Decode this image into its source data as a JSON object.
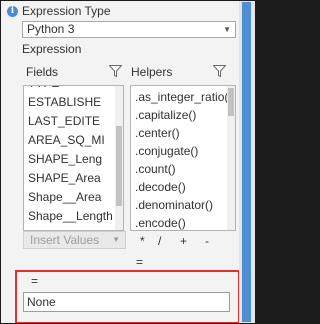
{
  "expression_type": {
    "label": "Expression Type",
    "selected": "Python 3"
  },
  "expression_label": "Expression",
  "fields": {
    "label": "Fields",
    "items": [
      "TYPE",
      "ESTABLISHE",
      "LAST_EDITE",
      "AREA_SQ_MI",
      "SHAPE_Leng",
      "SHAPE_Area",
      "Shape__Area",
      "Shape__Length"
    ]
  },
  "helpers": {
    "label": "Helpers",
    "items": [
      ".as_integer_ratio()",
      ".capitalize()",
      ".center()",
      ".conjugate()",
      ".count()",
      ".decode()",
      ".denominator()",
      ".encode()"
    ]
  },
  "insert_values": "Insert Values",
  "operators": [
    "*",
    "/",
    "+",
    "-",
    "="
  ],
  "result": {
    "label": "=",
    "value": "None"
  }
}
